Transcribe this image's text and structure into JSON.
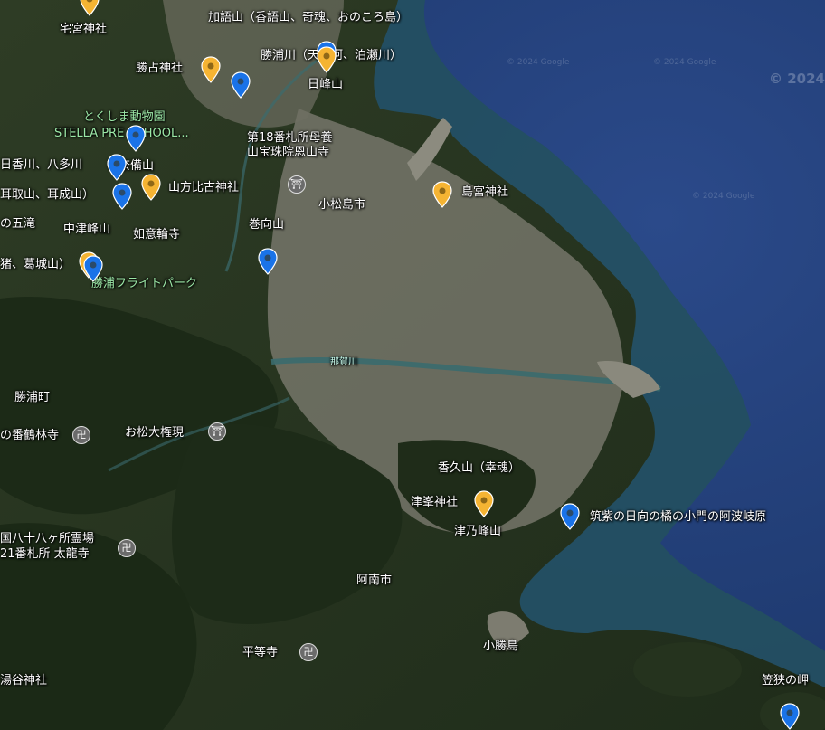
{
  "map": {
    "colors": {
      "ocean": "#1f3b72",
      "ocean_shallow": "#1f4f5e",
      "land_dark": "#26361f",
      "land_mid": "#3d4a2c",
      "urban": "#7c7b6e",
      "pin_blue": "#1a73e8",
      "pin_yellow": "#f5b433",
      "green_label": "#9be7a6"
    },
    "watermark": "© 2024 Google",
    "year_watermark": "© 2024",
    "labels": {
      "miyatake_shrine": "宅宮神社",
      "kagoyama": "加語山（香語山、奇魂、おのころ島）",
      "katsuura_river": "勝浦川（天安河、泊瀬川）",
      "katsusen_shrine": "勝占神社",
      "hinomine": "日峰山",
      "zoo": "とくしま動物園",
      "stella": "STELLA PRE SCHOOL...",
      "onzanji": "第18番札所母養\n山宝珠院恩山寺",
      "hikagawa": "日香川、八多川",
      "kannabiyama": "神奈備山",
      "mimitori": "耳取山、耳成山）",
      "yamahohiko": "山方比古神社",
      "komatsushima": "小松島市",
      "shimamiya": "島宮神社",
      "gotaki": "の五滝",
      "nakatsumine": "中津峰山",
      "nyoirinji": "如意輪寺",
      "makimukuyama": "巻向山",
      "katsuragi": "猪、葛城山）",
      "flight_park": "勝浦フライトパーク",
      "katsuura_town": "勝浦町",
      "kakurinji": "の番鶴林寺",
      "omatsu": "お松大権現",
      "kokuyama": "香久山（幸魂）",
      "tsumine_shrine": "津峯神社",
      "tsunomine": "津乃峰山",
      "tsukushi": "筑紫の日向の橘の小門の阿波岐原",
      "shikoku88": "国八十八ヶ所霊場",
      "tairyuji": "21番札所 太龍寺",
      "anan": "阿南市",
      "byodoji": "平等寺",
      "kogatsushima": "小勝島",
      "yutani": "湯谷神社",
      "kasasa": "笠狭の岬",
      "nakagawa_river": "那賀川"
    },
    "pins": [
      {
        "id": "pin-miyatake",
        "color": "yellow",
        "icon": "map-pin-icon"
      },
      {
        "id": "pin-katsusen",
        "color": "yellow"
      },
      {
        "id": "pin-katsuura-river",
        "color": "blue"
      },
      {
        "id": "pin-kagoyama",
        "color": "yellow"
      },
      {
        "id": "pin-hinomine",
        "color": "blue"
      },
      {
        "id": "pin-kannabi",
        "color": "blue"
      },
      {
        "id": "pin-hikagawa",
        "color": "blue"
      },
      {
        "id": "pin-mimitori",
        "color": "blue"
      },
      {
        "id": "pin-yamahohiko",
        "color": "yellow"
      },
      {
        "id": "pin-shimamiya",
        "color": "yellow"
      },
      {
        "id": "pin-makimuku",
        "color": "blue"
      },
      {
        "id": "pin-katsuragi-y",
        "color": "yellow"
      },
      {
        "id": "pin-katsuragi-b",
        "color": "blue"
      },
      {
        "id": "pin-tsumine",
        "color": "yellow"
      },
      {
        "id": "pin-tsukushi",
        "color": "blue"
      },
      {
        "id": "pin-kasasa",
        "color": "blue"
      }
    ]
  }
}
